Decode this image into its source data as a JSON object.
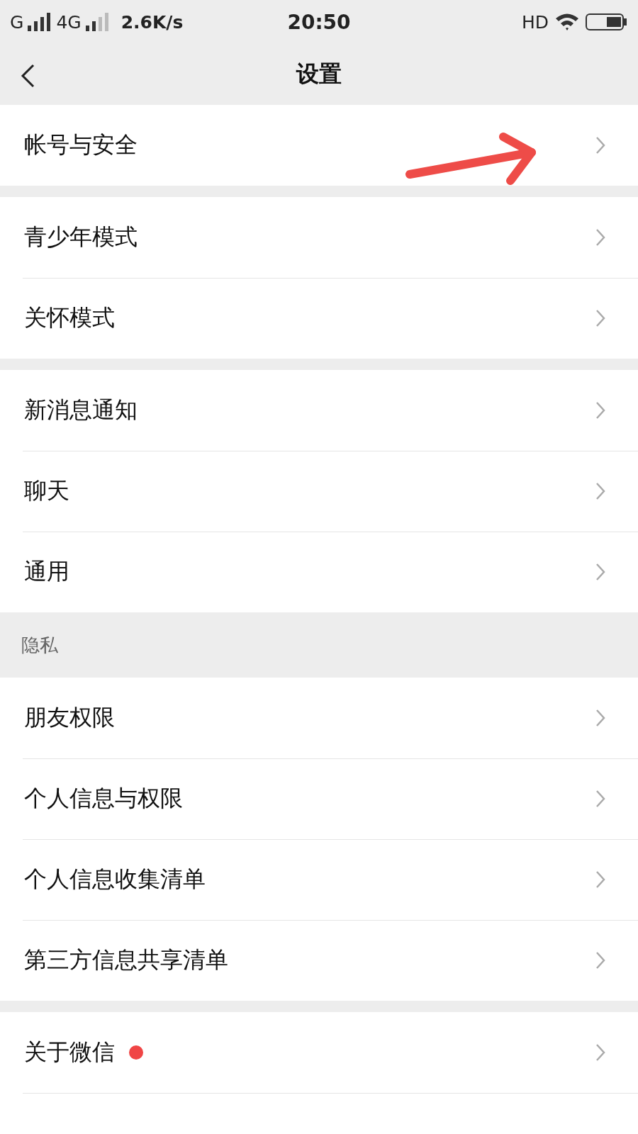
{
  "status_bar": {
    "network_1": "G",
    "network_2": "4G",
    "speed": "2.6K/s",
    "time": "20:50",
    "hd": "HD"
  },
  "nav": {
    "title": "设置"
  },
  "sections": [
    {
      "items": [
        {
          "label": "帐号与安全",
          "badge": false
        }
      ]
    },
    {
      "items": [
        {
          "label": "青少年模式",
          "badge": false
        },
        {
          "label": "关怀模式",
          "badge": false
        }
      ]
    },
    {
      "items": [
        {
          "label": "新消息通知",
          "badge": false
        },
        {
          "label": "聊天",
          "badge": false
        },
        {
          "label": "通用",
          "badge": false
        }
      ]
    },
    {
      "header": "隐私",
      "items": [
        {
          "label": "朋友权限",
          "badge": false
        },
        {
          "label": "个人信息与权限",
          "badge": false
        },
        {
          "label": "个人信息收集清单",
          "badge": false
        },
        {
          "label": "第三方信息共享清单",
          "badge": false
        }
      ]
    },
    {
      "items": [
        {
          "label": "关于微信",
          "badge": true
        }
      ]
    }
  ]
}
